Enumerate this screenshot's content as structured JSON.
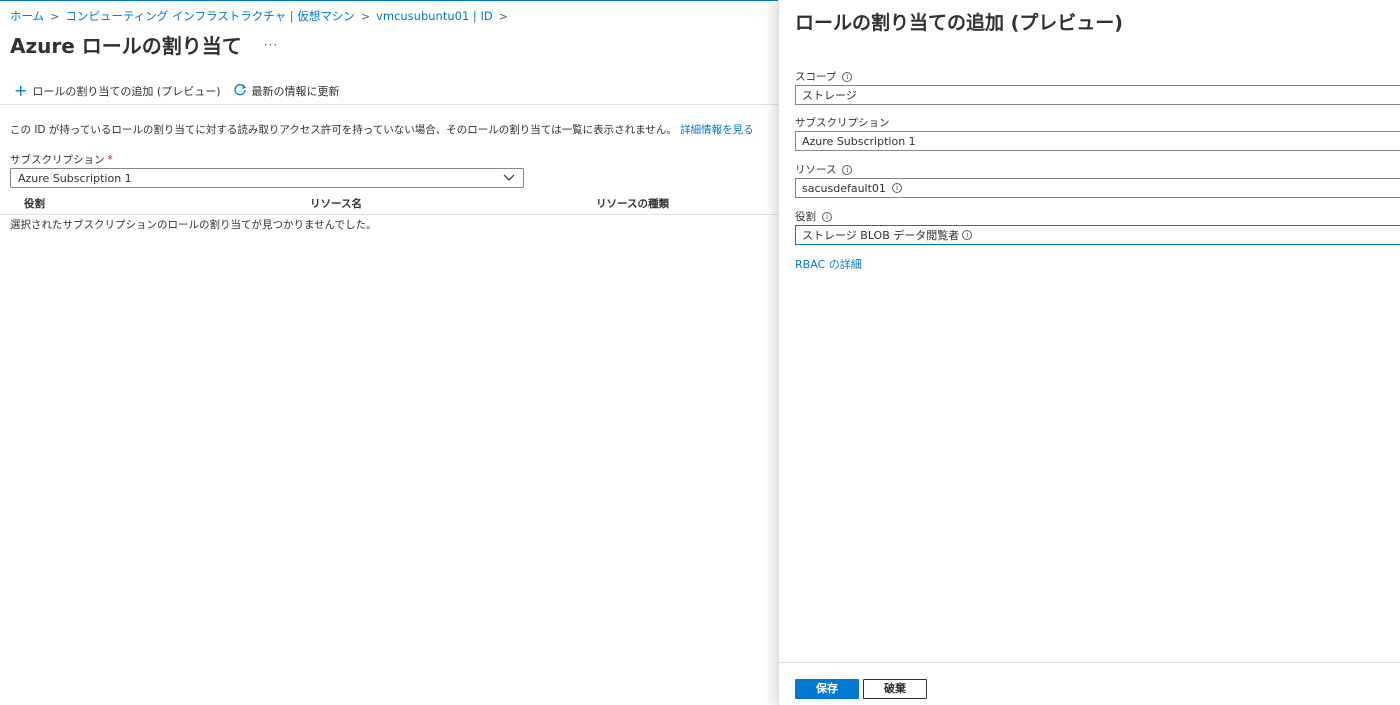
{
  "breadcrumb": {
    "items": [
      "ホーム",
      "コンピューティング インフラストラクチャ | 仮想マシン",
      "vmcusubuntu01 | ID"
    ]
  },
  "page": {
    "title": "Azure ロールの割り当て",
    "more": "···"
  },
  "toolbar": {
    "add_label": "ロールの割り当ての追加 (プレビュー)",
    "refresh_label": "最新の情報に更新"
  },
  "info": {
    "text": "この ID が持っているロールの割り当てに対する読み取りアクセス許可を持っていない場合、そのロールの割り当ては一覧に表示されません。",
    "link": "詳細情報を見る"
  },
  "subscription": {
    "label": "サブスクリプション",
    "required": "*",
    "value": "Azure Subscription 1"
  },
  "table": {
    "columns": [
      "役割",
      "リソース名",
      "リソースの種類"
    ],
    "empty_message": "選択されたサブスクリプションのロールの割り当てが見つかりませんでした。"
  },
  "panel": {
    "title": "ロールの割り当ての追加 (プレビュー)",
    "scope_label": "スコープ",
    "scope_value": "ストレージ",
    "subscription_label": "サブスクリプション",
    "subscription_value": "Azure Subscription 1",
    "resource_label": "リソース",
    "resource_value": "sacusdefault01",
    "role_label": "役割",
    "role_value": "ストレージ BLOB データ閲覧者",
    "rbac_link": "RBAC の詳細",
    "save_label": "保存",
    "discard_label": "破棄"
  },
  "colors": {
    "accent": "#0078d4",
    "required": "#a4262c"
  }
}
